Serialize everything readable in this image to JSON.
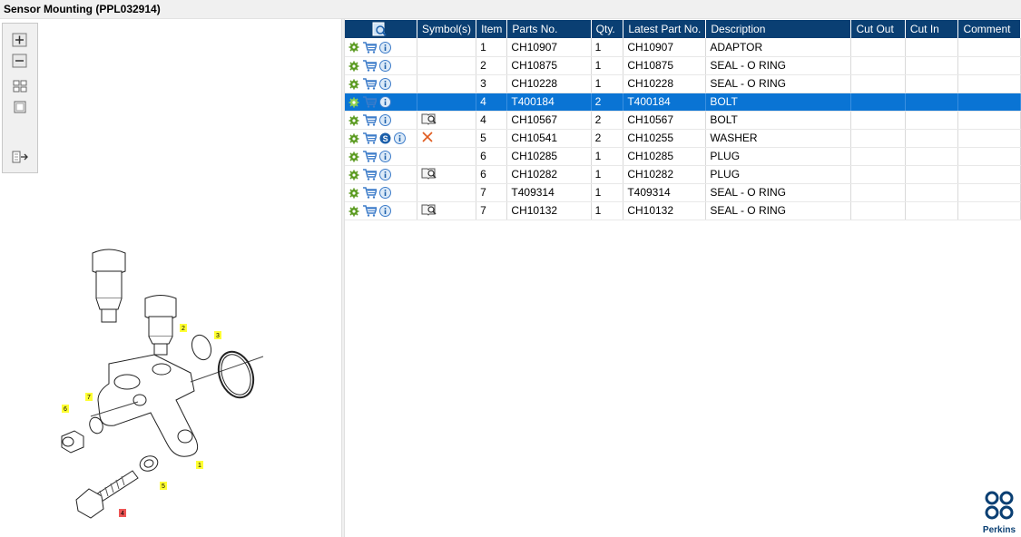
{
  "window": {
    "title": "Sensor Mounting (PPL032914)"
  },
  "toolbox": {
    "items": [
      {
        "name": "zoom-in-icon"
      },
      {
        "name": "zoom-out-icon"
      },
      {
        "name": "fit-page-icon"
      },
      {
        "name": "actual-size-icon"
      },
      {
        "name": "export-icon"
      }
    ]
  },
  "diagram": {
    "callouts": [
      "1",
      "2",
      "3",
      "4",
      "5",
      "6",
      "7"
    ]
  },
  "table": {
    "columns": [
      "",
      "Symbol(s)",
      "Item",
      "Parts No.",
      "Qty.",
      "Latest Part No.",
      "Description",
      "Cut Out",
      "Cut In",
      "Comment"
    ],
    "rows": [
      {
        "s": false,
        "sym": "",
        "item": "1",
        "part": "CH10907",
        "qty": "1",
        "latest": "CH10907",
        "desc": "ADAPTOR",
        "selected": false
      },
      {
        "s": false,
        "sym": "",
        "item": "2",
        "part": "CH10875",
        "qty": "1",
        "latest": "CH10875",
        "desc": "SEAL - O RING",
        "selected": false
      },
      {
        "s": false,
        "sym": "",
        "item": "3",
        "part": "CH10228",
        "qty": "1",
        "latest": "CH10228",
        "desc": "SEAL - O RING",
        "selected": false
      },
      {
        "s": false,
        "sym": "",
        "item": "4",
        "part": "T400184",
        "qty": "2",
        "latest": "T400184",
        "desc": "BOLT",
        "selected": true
      },
      {
        "s": false,
        "sym": "book",
        "item": "4",
        "part": "CH10567",
        "qty": "2",
        "latest": "CH10567",
        "desc": "BOLT",
        "selected": false
      },
      {
        "s": true,
        "sym": "cross",
        "item": "5",
        "part": "CH10541",
        "qty": "2",
        "latest": "CH10255",
        "desc": "WASHER",
        "selected": false
      },
      {
        "s": false,
        "sym": "",
        "item": "6",
        "part": "CH10285",
        "qty": "1",
        "latest": "CH10285",
        "desc": "PLUG",
        "selected": false
      },
      {
        "s": false,
        "sym": "book",
        "item": "6",
        "part": "CH10282",
        "qty": "1",
        "latest": "CH10282",
        "desc": "PLUG",
        "selected": false
      },
      {
        "s": false,
        "sym": "",
        "item": "7",
        "part": "T409314",
        "qty": "1",
        "latest": "T409314",
        "desc": "SEAL - O RING",
        "selected": false
      },
      {
        "s": false,
        "sym": "book",
        "item": "7",
        "part": "CH10132",
        "qty": "1",
        "latest": "CH10132",
        "desc": "SEAL - O RING",
        "selected": false
      }
    ]
  },
  "brand": {
    "name": "Perkins",
    "color": "#0a3f73"
  },
  "colors": {
    "header": "#0a3f73",
    "selection": "#0a74d4",
    "gear": "#5a9a1f",
    "info": "#3d7cc9",
    "cross": "#e05a1e"
  }
}
